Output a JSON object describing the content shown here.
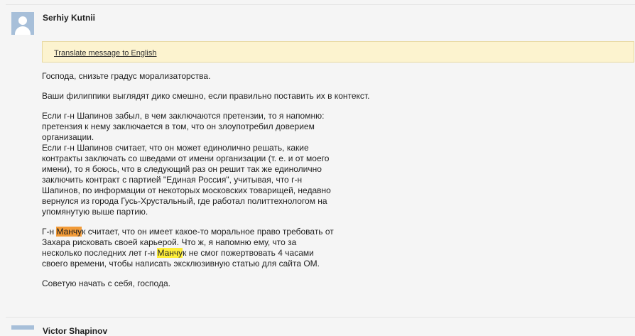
{
  "message": {
    "sender": "Serhiy Kutnii",
    "translate_link": "Translate message to English",
    "paragraphs": [
      [
        "Господа, снизьте градус морализаторства."
      ],
      [
        "Ваши филиппики выглядят дико смешно, если правильно поставить их в контекст."
      ],
      [
        "Если г-н Шапинов забыл, в чем заключаются претензии, то я напомню:",
        "претензия к нему заключается в том, что он злоупотребил доверием",
        "организации.",
        "Если г-н Шапинов считает, что он может единолично решать, какие",
        "контракты заключать со шведами от имени организации (т. е. и от моего",
        "имени), то я боюсь, что в следующий раз он решит так же единолично",
        "заключить контракт с партией \"Единая Россия\", учитывая, что г-н",
        "Шапинов, по информации от некоторых московских товарищей, недавно",
        "вернулся из города Гусь-Хрустальный, где работал политтехнологом на",
        "упомянутую выше партию."
      ]
    ],
    "para4": {
      "l1_pre": "Г-н ",
      "l1_hl": "Манчу",
      "l1_post": "к считает, что он имеет какое-то моральное право требовать от",
      "l2": "Захара рисковать своей карьерой. Что ж, я напомню ему, что за",
      "l3_pre": "несколько последних лет г-н ",
      "l3_hl": "Манчу",
      "l3_post": "к не смог пожертвовать 4 часами",
      "l4": "своего времени, чтобы написать эксклюзивную статью для сайта ОМ."
    },
    "closing": "Советую начать с себя, господа."
  },
  "next_message": {
    "sender": "Victor Shapinov"
  },
  "colors": {
    "translate_bg": "#fcf3cf",
    "highlight_orange": "#f29b38",
    "highlight_yellow": "#ffef3a"
  },
  "icons": {
    "avatar": "default-avatar-icon"
  }
}
